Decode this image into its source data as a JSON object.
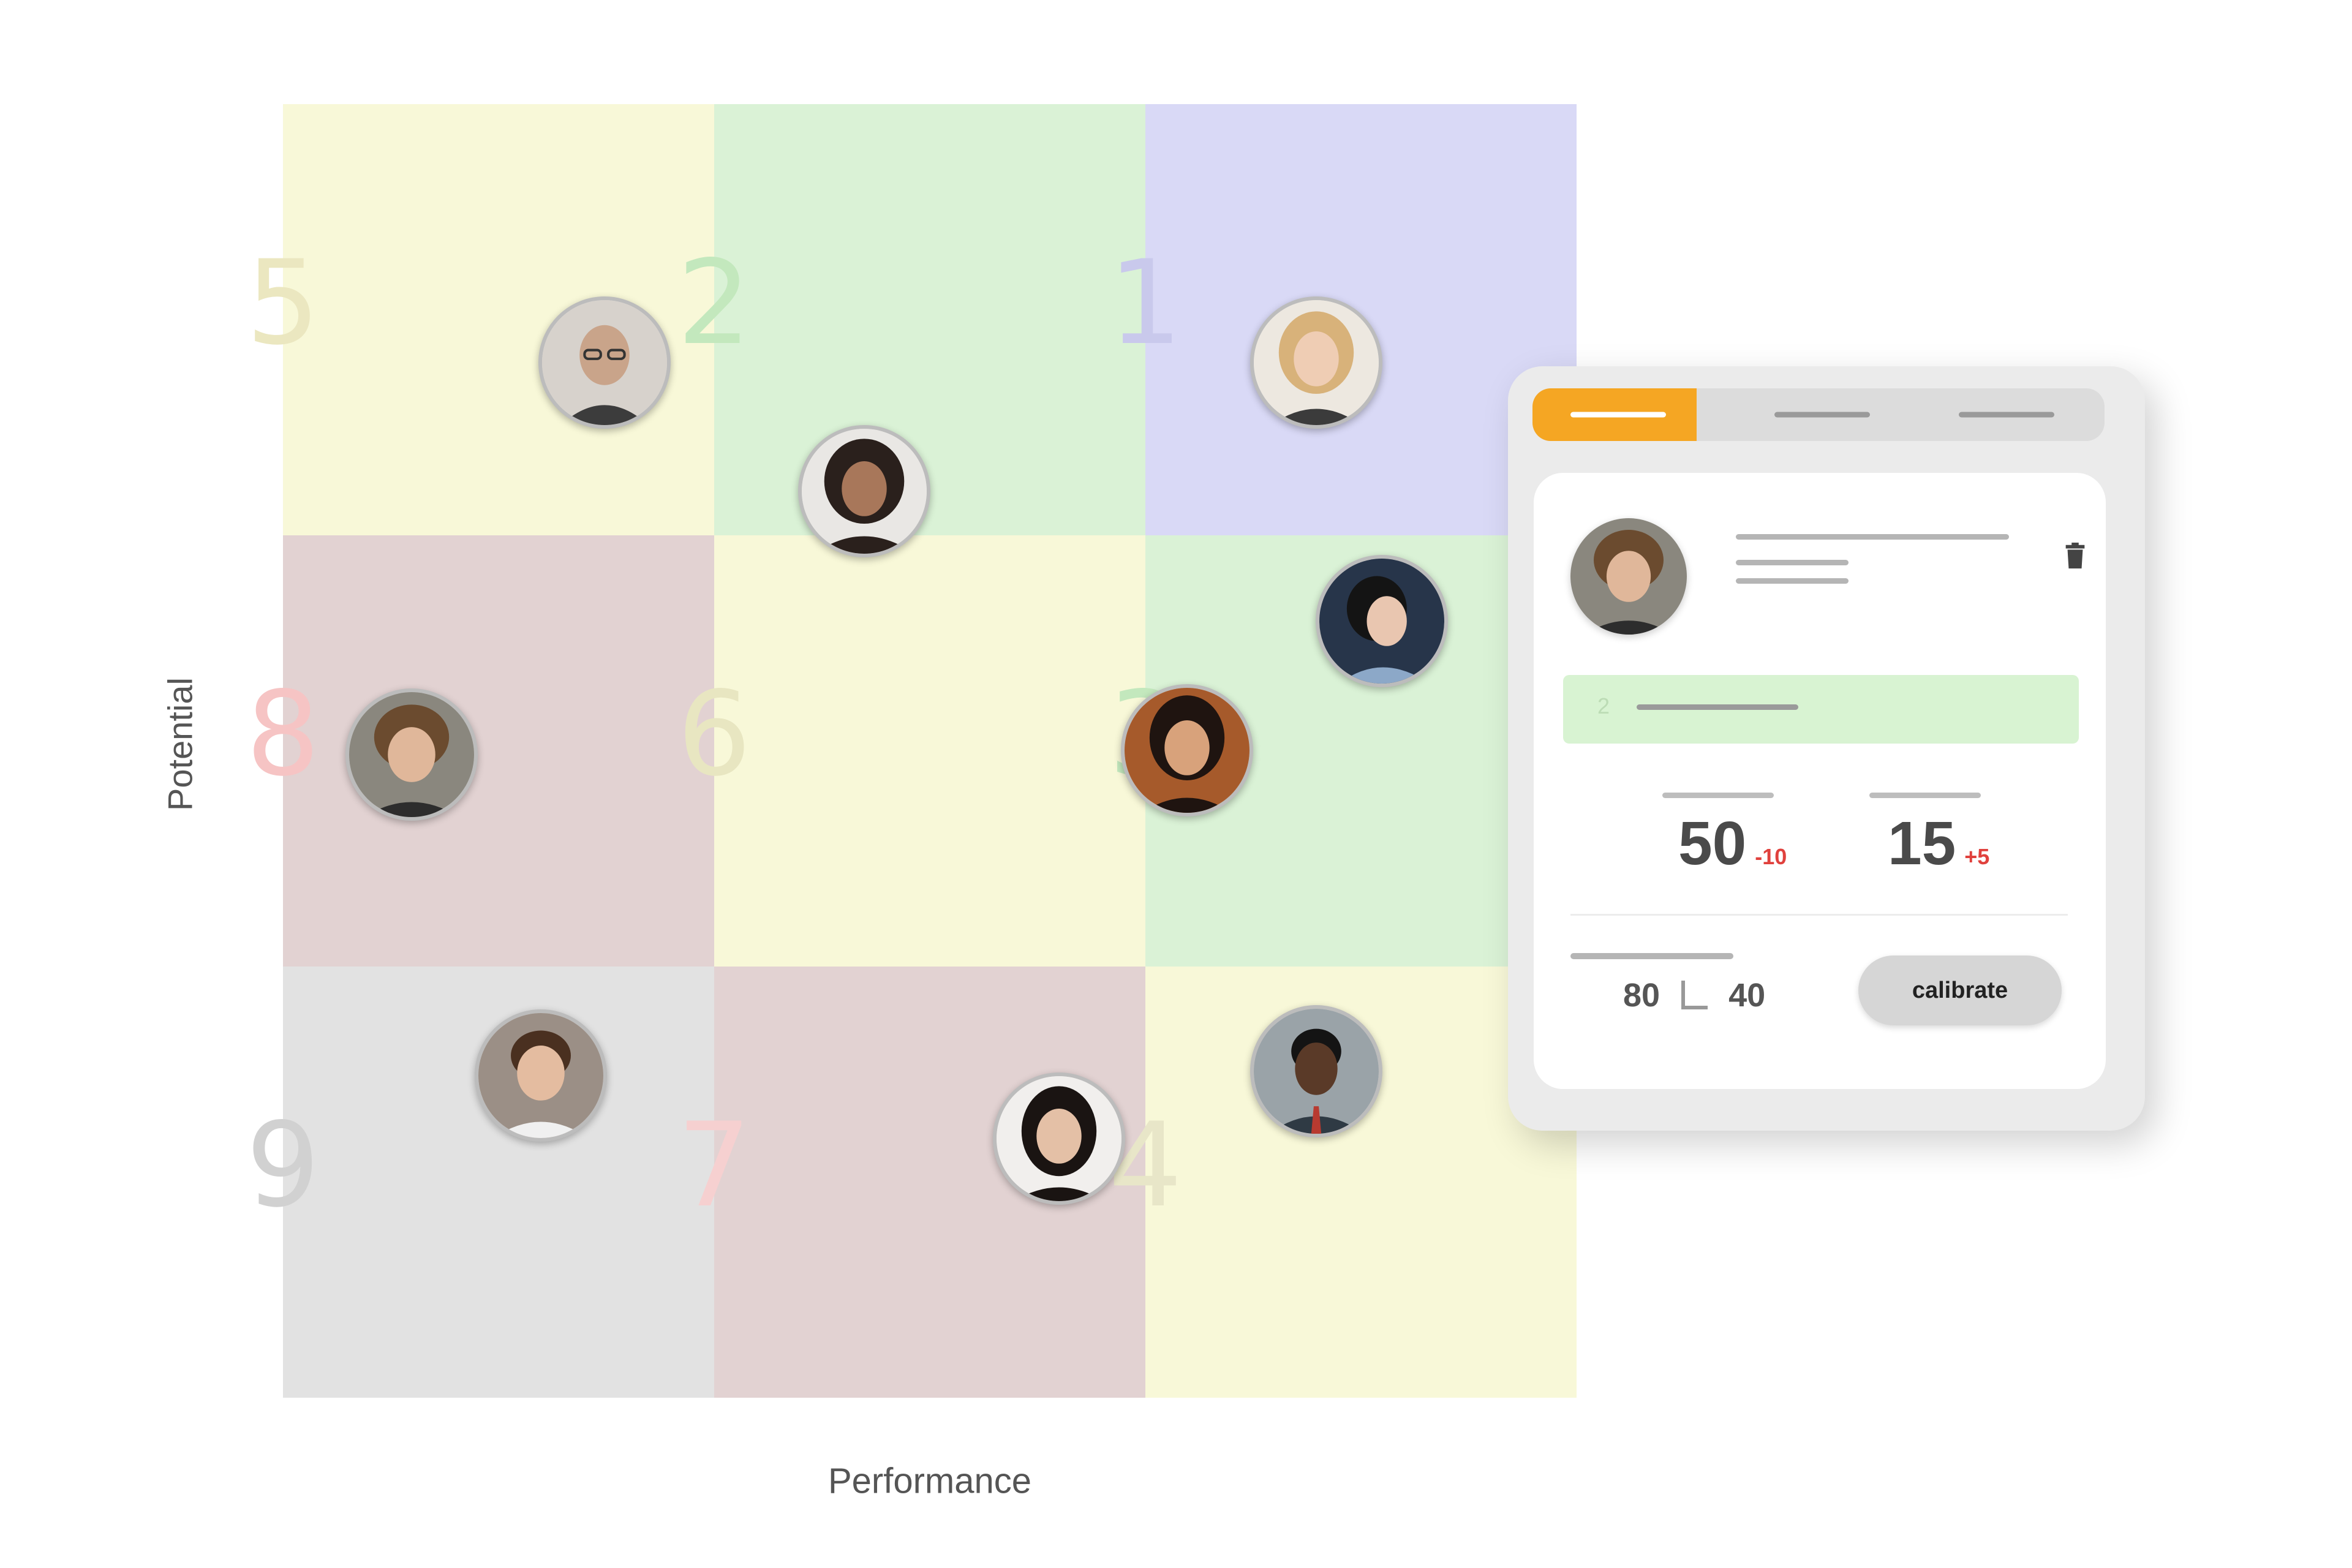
{
  "axes": {
    "y_label": "Potential",
    "x_label": "Performance"
  },
  "grid": {
    "cells": [
      {
        "number": "5",
        "color": "#f8f8d8",
        "num_color": "#ebe7c0"
      },
      {
        "number": "2",
        "color": "#daf2d6",
        "num_color": "#c3e8bd"
      },
      {
        "number": "1",
        "color": "#d9d9f6",
        "num_color": "#c9c9ec"
      },
      {
        "number": "8",
        "color": "#e2d2d2",
        "num_color": "#f6c4c4"
      },
      {
        "number": "6",
        "color": "#f8f8d8",
        "num_color": "#e8e6c1"
      },
      {
        "number": "3",
        "color": "#daf2d6",
        "num_color": "#c3e8bd"
      },
      {
        "number": "9",
        "color": "#e2e2e2",
        "num_color": "#d1d1d1"
      },
      {
        "number": "7",
        "color": "#e2d2d2",
        "num_color": "#f6d0d0"
      },
      {
        "number": "4",
        "color": "#f8f8d8",
        "num_color": "#e8e6c8"
      }
    ]
  },
  "people": [
    {
      "name": "avatar-bald-man-glasses",
      "cell": "5"
    },
    {
      "name": "avatar-curly-hair-woman",
      "cell": "2"
    },
    {
      "name": "avatar-blonde-woman",
      "cell": "1"
    },
    {
      "name": "avatar-curly-hair-boy",
      "cell": "8"
    },
    {
      "name": "avatar-smiling-woman",
      "cell": "6"
    },
    {
      "name": "avatar-ponytail-woman",
      "cell": "3"
    },
    {
      "name": "avatar-young-man",
      "cell": "9"
    },
    {
      "name": "avatar-dark-hair-woman",
      "cell": "7"
    },
    {
      "name": "avatar-man-suit",
      "cell": "4"
    }
  ],
  "panel": {
    "score_row_number": "2",
    "metric1": {
      "value": "50",
      "delta": "-10"
    },
    "metric2": {
      "value": "15",
      "delta": "+5"
    },
    "stat_left": "80",
    "stat_right": "40",
    "calibrate_label": "calibrate",
    "accent_color": "#f5a623",
    "icons": [
      "trash-icon",
      "corner-bracket-icon"
    ]
  }
}
